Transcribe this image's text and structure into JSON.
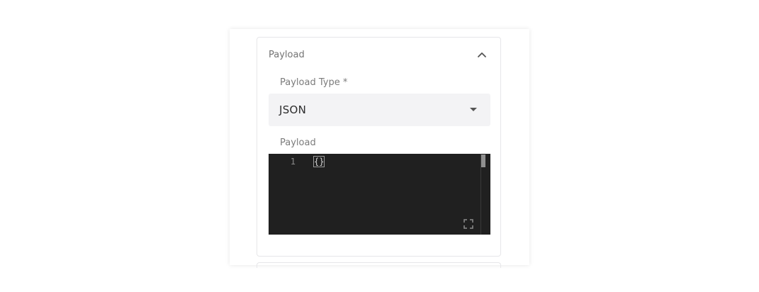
{
  "panel": {
    "title": "Payload",
    "collapse_icon": "chevron-up-icon"
  },
  "payload_type": {
    "label": "Payload Type *",
    "value": "JSON",
    "arrow_icon": "caret-down-icon"
  },
  "payload": {
    "label": "Payload",
    "editor": {
      "lines": [
        {
          "number": "1",
          "code": "{}"
        }
      ],
      "background": "#202020",
      "expand_icon": "fullscreen-icon"
    }
  }
}
